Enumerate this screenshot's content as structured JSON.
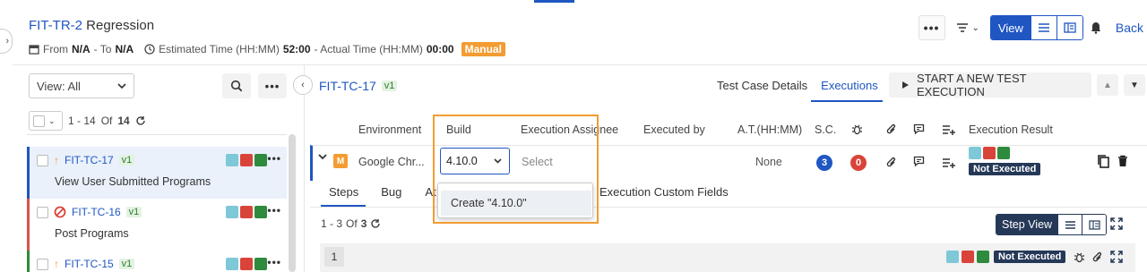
{
  "header": {
    "issue_key": "FIT-TR-2",
    "issue_name": "Regression",
    "from_label": "From",
    "from_value": "N/A",
    "to_label": "- To",
    "to_value": "N/A",
    "estimated_label": "Estimated Time (HH:MM)",
    "estimated_value": "52:00",
    "actual_label": "- Actual Time (HH:MM)",
    "actual_value": "00:00",
    "type_badge": "Manual",
    "view_label": "View",
    "back_label": "Back"
  },
  "left_pane": {
    "view_select": "View: All",
    "list_range": "1 - 14",
    "list_of": "Of",
    "list_total": "14",
    "items": [
      {
        "key": "FIT-TC-17",
        "version": "v1",
        "title": "View User Submitted Programs",
        "priority": "up",
        "bar_color": "#1f56c2"
      },
      {
        "key": "FIT-TC-16",
        "version": "v1",
        "title": "Post Programs",
        "priority": "blocked",
        "bar_color": "#d9534f"
      },
      {
        "key": "FIT-TC-15",
        "version": "v1",
        "title": "",
        "priority": "up",
        "bar_color": "#2e8b3d"
      }
    ]
  },
  "right_pane": {
    "tc_key": "FIT-TC-17",
    "tc_version": "v1",
    "tabs": [
      "Test Case Details",
      "Executions"
    ],
    "active_tab": "Executions",
    "start_button": "START A NEW TEST EXECUTION",
    "columns": {
      "environment": "Environment",
      "build": "Build",
      "assignee": "Execution Assignee",
      "executed_by": "Executed by",
      "at": "A.T.(HH:MM)",
      "sc": "S.C.",
      "result": "Execution Result"
    },
    "row": {
      "badge": "M",
      "environment": "Google Chr...",
      "build_value": "4.10.0",
      "assignee_placeholder": "Select",
      "at_value": "None",
      "sc_count": "3",
      "defect_count": "0",
      "result": "Not Executed"
    },
    "dropdown_item": "Create \"4.10.0\"",
    "sub_tabs": [
      "Steps",
      "Bug",
      "At",
      "Execution Custom Fields"
    ],
    "steps_range": "1 - 3",
    "steps_of": "Of",
    "steps_total": "3",
    "step_view_label": "Step View",
    "step_row": {
      "number": "1",
      "result": "Not Executed"
    }
  },
  "colors": {
    "accent": "#1f56c2",
    "manual": "#f39c32",
    "status_teal": "#7ec8d8",
    "status_red": "#d9443a",
    "status_green": "#2e8b3d",
    "not_executed": "#253858"
  }
}
